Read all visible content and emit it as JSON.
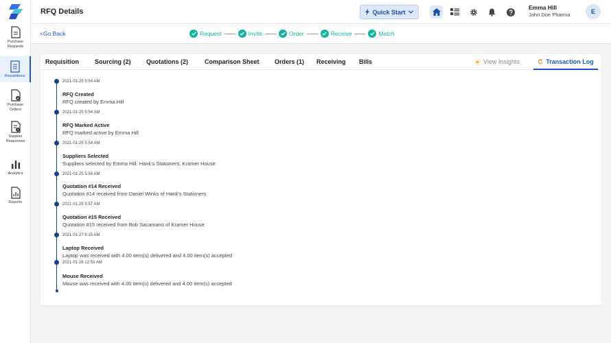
{
  "header": {
    "title": "RFQ Details",
    "quick_start": "Quick Start",
    "user_name": "Emma Hill",
    "user_org": "John Doe Pharma",
    "avatar_initial": "E"
  },
  "sidebar": {
    "items": [
      {
        "label_line1": "Purchase",
        "label_line2": "Requests",
        "icon": "document-icon"
      },
      {
        "label_line1": "Requisitions",
        "label_line2": "",
        "icon": "list-document-icon",
        "active": true
      },
      {
        "label_line1": "Purchase",
        "label_line2": "Orders",
        "icon": "document-check-icon"
      },
      {
        "label_line1": "Supplier",
        "label_line2": "Responses",
        "icon": "document-clock-icon"
      },
      {
        "label_line1": "Analytics",
        "label_line2": "",
        "icon": "bar-chart-icon"
      },
      {
        "label_line1": "Reports",
        "label_line2": "",
        "icon": "report-icon"
      }
    ]
  },
  "subbar": {
    "go_back": "<Go Back",
    "steps": [
      "Request",
      "Invite",
      "Order",
      "Receive",
      "Match"
    ]
  },
  "tabs": {
    "items": [
      "Requisition",
      "Sourcing (2)",
      "Quotations (2)",
      "Comparison Sheet",
      "Orders (1)",
      "Receiving",
      "Bills"
    ],
    "insights": "View Insights",
    "log": "Transaction Log"
  },
  "timeline": [
    {
      "ts": "2021-01-25 5:54 AM",
      "title": "RFQ Created",
      "desc": "RFQ created by Emma Hill"
    },
    {
      "ts": "2021-01-25 5:54 AM",
      "title": "RFQ Marked Active",
      "desc": "RFQ marked active by Emma Hill"
    },
    {
      "ts": "2021-01-25 5:54 AM",
      "title": "Suppliers Selected",
      "desc": "Suppliers selected by Emma Hill: Hank's Stationers, Kramer House"
    },
    {
      "ts": "2021-01-25 5:56 AM",
      "title": "Quotation #14 Received",
      "desc": "Quotation #14 received from Daniel Winks of Hank's Stationers"
    },
    {
      "ts": "2021-01-25 5:57 AM",
      "title": "Quotation #15 Received",
      "desc": "Quotation #15 received from Bob Sacamano of Kramer House"
    },
    {
      "ts": "2021-01-27 6:15 AM",
      "title": "Laptop Received",
      "desc": "Laptop was received with 4.00 item(s) delivered and 4.00 item(s) accepted"
    },
    {
      "ts": "2021-01-26 12:53 AM",
      "title": "Mouse Received",
      "desc": "Mouse was received with 4.00 item(s) delivered and 4.00 item(s) accepted"
    }
  ],
  "colors": {
    "accent": "#1a56c4",
    "step_done": "#13b3a0",
    "timeline": "#1a3f8f"
  }
}
